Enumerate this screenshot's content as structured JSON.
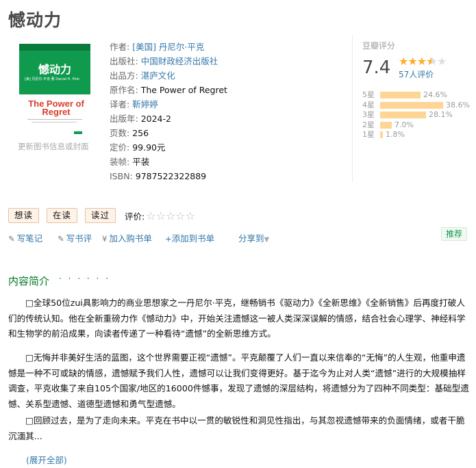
{
  "book": {
    "title": "憾动力",
    "update_cover": "更新图书信息或封面",
    "cover": {
      "title": "憾动力",
      "authors": "[美] 丹尼尔·平克 著   Daniel H. Pink",
      "english_title": "The Power of Regret"
    }
  },
  "info": [
    {
      "label": "作者:",
      "value": "[美国] 丹尼尔·平克",
      "link": true
    },
    {
      "label": "出版社:",
      "value": "中国财政经济出版社",
      "link": true
    },
    {
      "label": "出品方:",
      "value": "湛庐文化",
      "link": true
    },
    {
      "label": "原作名:",
      "value": "The Power of Regret",
      "link": false
    },
    {
      "label": "译者:",
      "value": "靳婷婷",
      "link": true
    },
    {
      "label": "出版年:",
      "value": "2024-2",
      "link": false
    },
    {
      "label": "页数:",
      "value": "256",
      "link": false
    },
    {
      "label": "定价:",
      "value": "99.90元",
      "link": false
    },
    {
      "label": "装帧:",
      "value": "平装",
      "link": false
    },
    {
      "label": "ISBN:",
      "value": "9787522322889",
      "link": false
    }
  ],
  "rating": {
    "title": "豆瓣评分",
    "score": "7.4",
    "count": "57人评价",
    "stars_filled": 3.5,
    "distribution": [
      {
        "label": "5星",
        "pct": "24.6%",
        "value": 24.6
      },
      {
        "label": "4星",
        "pct": "38.6%",
        "value": 38.6
      },
      {
        "label": "3星",
        "pct": "28.1%",
        "value": 28.1
      },
      {
        "label": "2星",
        "pct": "7.0%",
        "value": 7.0
      },
      {
        "label": "1星",
        "pct": "1.8%",
        "value": 1.8
      }
    ]
  },
  "status": {
    "want": "想读",
    "reading": "在读",
    "read": "读过",
    "rate_label": "评价:"
  },
  "actions": {
    "write_note": "写笔记",
    "write_review": "写书评",
    "add_cart": "加入购书单",
    "add_booklist": "添加到书单",
    "share": "分享到",
    "recommend": "推荐"
  },
  "summary": {
    "title": "内容简介",
    "dots": "· · · · · ·",
    "paragraphs": [
      "□全球50位zui具影响力的商业思想家之一丹尼尔·平克，继畅销书《驱动力》《全新思维》《全新销售》后再度打破人们的传统认知。他在全新重磅力作《憾动力》中，开始关注遗憾这一被人类深深误解的情感，结合社会心理学、神经科学和生物学的前沿成果，向读者传递了一种看待“遗憾”的全新思维方式。",
      "□无悔并非美好生活的蓝图，这个世界需要正视“遗憾”。平克颠覆了人们一直以来信奉的“无悔”的人生观，他重申遗憾是一种不可或缺的情感，遗憾赋予我们人性，遗憾可以让我们变得更好。基于迄今为止对人类“遗憾”进行的大规模抽样调查，平克收集了来自105个国家/地区的16000件憾事，发现了遗憾的深层结构，将遗憾分为了四种不同类型：基础型遗憾、关系型遗憾、道德型遗憾和勇气型遗憾。",
      "□回顾过去，是为了走向未来。平克在书中以一贯的敏锐性和洞见性指出，与其忽视遗憾带来的负面情绪，或者干脆沉湎其..."
    ],
    "expand": "(展开全部)"
  }
}
